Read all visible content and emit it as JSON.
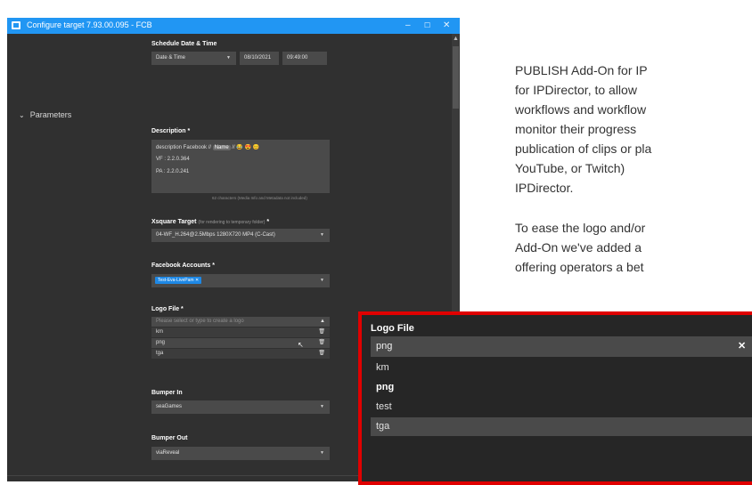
{
  "window": {
    "title": "Configure target 7.93.00.095 - FCB",
    "minimize_glyph": "–",
    "maximize_glyph": "☐",
    "close_glyph": "✕"
  },
  "schedule": {
    "label": "Schedule Date & Time",
    "mode": "Date & Time",
    "date": "08/10/2021",
    "time": "09:49:00"
  },
  "parameters": {
    "section_label": "Parameters",
    "description": {
      "label": "Description *",
      "line1_prefix": "description Facebook // ",
      "name_pill": "Name",
      "line1_suffix": " // 😂 😍 😊",
      "line2": "VF : 2.2.0.364",
      "line3": "PA : 2.2.0.241",
      "counter": "62 characters (Media Info and Metadata not included)"
    },
    "xsquare": {
      "label": "Xsquare Target",
      "hint": "(for rendering to temporary folder)",
      "required": "*",
      "value": "04-WF_H.264@2.5Mbps 1280X720 MP4 (C-Cast)"
    },
    "facebook": {
      "label": "Facebook Accounts *",
      "chip": "Test-Eva-LivePam ✕"
    },
    "logo": {
      "label": "Logo File *",
      "placeholder": "Please select or type to create a logo",
      "options": [
        "km",
        "png",
        "tga"
      ]
    },
    "bumper_in": {
      "label": "Bumper In",
      "value": "seaGames"
    },
    "bumper_out": {
      "label": "Bumper Out",
      "value": "viaReveal"
    }
  },
  "doc_text": {
    "lines": [
      "PUBLISH Add-On for IP",
      "for IPDirector, to allow",
      "workflows and workflow",
      "monitor their progress",
      "publication of clips or pla",
      "YouTube, or Twitch)",
      "IPDirector.",
      "To ease the logo and/or",
      "Add-On we've added a",
      "offering operators a bet"
    ]
  },
  "zoom": {
    "label": "Logo File",
    "input_value": "png",
    "clear_glyph": "✕",
    "options": [
      "km",
      "png",
      "test",
      "tga"
    ]
  },
  "colors": {
    "titlebar": "#2196f3",
    "highlight_border": "#e00000",
    "chip": "#1e88e5"
  }
}
